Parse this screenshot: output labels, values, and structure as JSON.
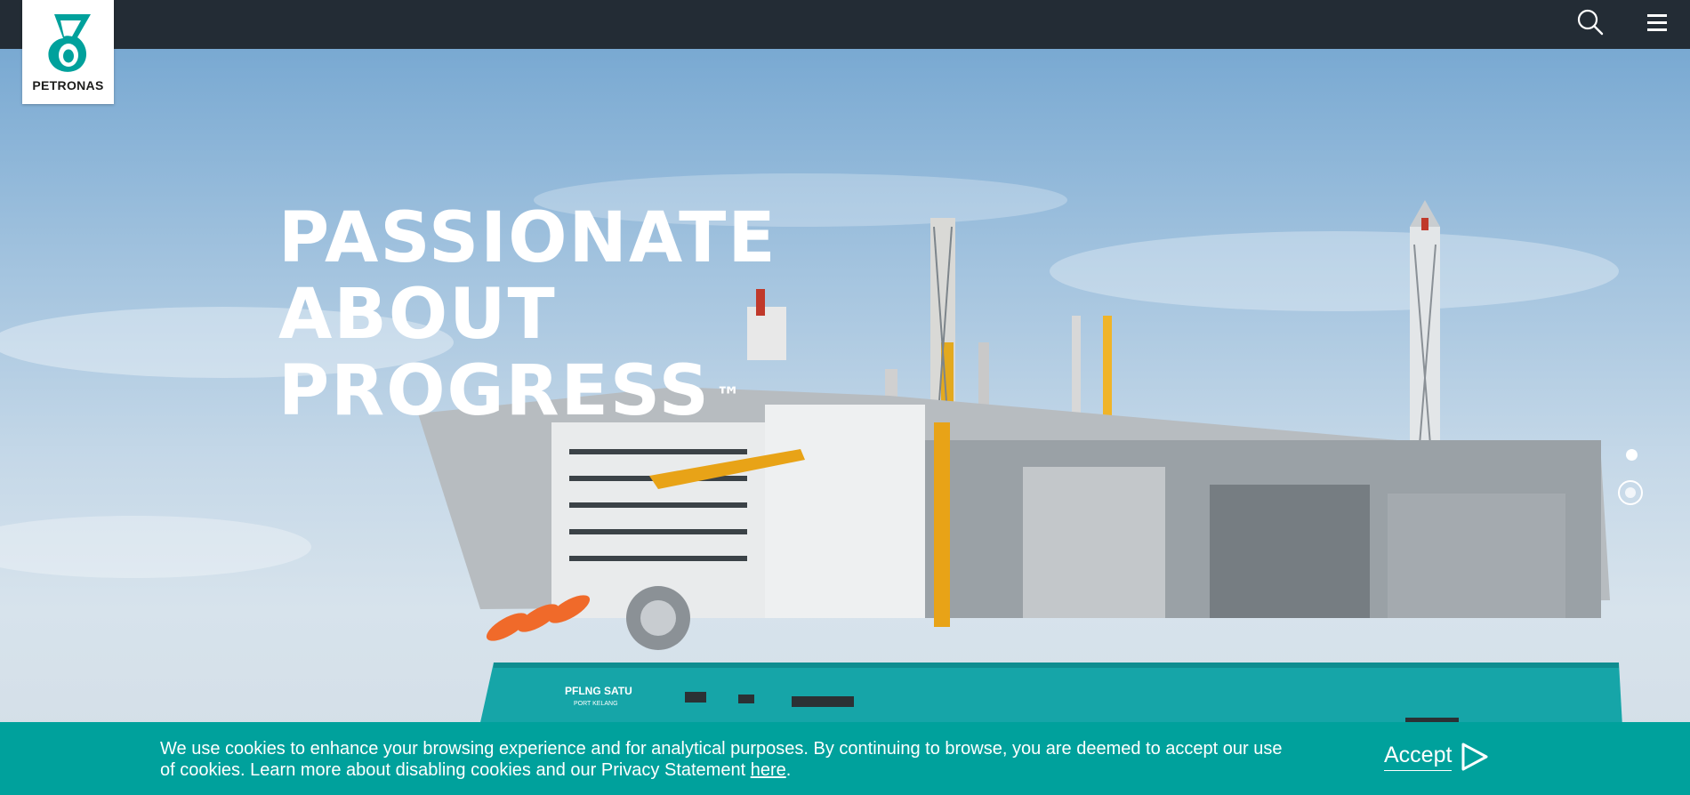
{
  "brand": {
    "name": "PETRONAS",
    "teal": "#00a19c",
    "dark": "#232c35"
  },
  "header": {
    "icons": [
      "search-icon",
      "hamburger-menu-icon"
    ]
  },
  "hero": {
    "headline": [
      "PASSIONATE",
      "ABOUT",
      "PROGRESS"
    ],
    "trademark": "™",
    "vessel_name": "PFLNG SATU",
    "vessel_port": "PORT KELANG",
    "slide_count": 2,
    "active_slide": 2
  },
  "cookie_banner": {
    "text_before_link": "We use cookies to enhance your browsing experience and for analytical purposes. By continuing to browse, you are deemed to accept our use of cookies. Learn more about disabling cookies and our Privacy Statement ",
    "link_text": "here",
    "text_after_link": ".",
    "accept_label": "Accept"
  }
}
